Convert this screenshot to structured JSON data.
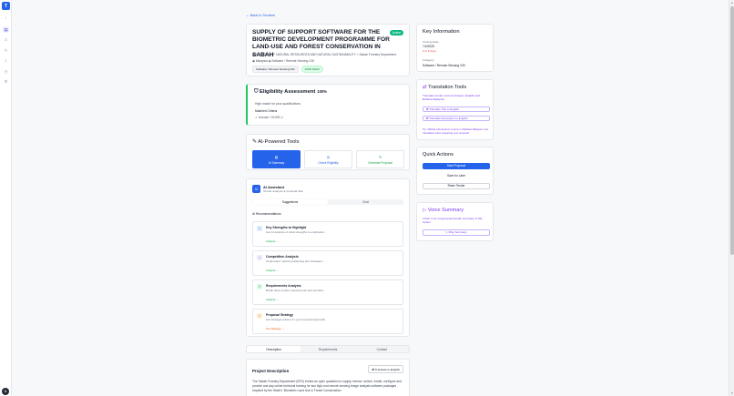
{
  "rail": {
    "logo": "T",
    "avatar": "N"
  },
  "back_link": "← Back to Tenders",
  "tender": {
    "title": "SUPPLY OF SUPPORT SOFTWARE FOR THE BIOMETRIC DEVELOPMENT PROGRAMME FOR LAND-USE AND FOREST CONSERVATION IN SABAH",
    "status": "Active",
    "ministry": "MINISTRY OF NATURAL RESOURCES AND NATURAL SUSTAINABILITY > Sabah Forestry Department",
    "location": "Malaysia",
    "category_meta": "Software / Remote Sensing GIS",
    "tag_category": "Software / Remote Sensing GIS",
    "tag_match": "100% Match"
  },
  "eligibility": {
    "title": "Eligibility Assessment",
    "percent": "100%",
    "subtitle": "High match for your qualifications",
    "matched_label": "Matched Criteria",
    "license": "License / 01/251-1"
  },
  "ai_tools": {
    "title": "AI-Powered Tools",
    "buttons": [
      "AI Summary",
      "Check Eligibility",
      "Generate Proposal"
    ]
  },
  "assistant": {
    "title": "AI Assistant",
    "subtitle": "Tender analysis & proposal help",
    "tabs": [
      "Suggestions",
      "Chat"
    ],
    "rec_heading": "AI Recommendations",
    "items": [
      {
        "title": "Key Strengths to Highlight",
        "desc": "Get AI analysis of what strengths to emphasize",
        "action": "Analyze →"
      },
      {
        "title": "Competition Analysis",
        "desc": "Understand market positioning and strategies",
        "action": "Analyze →"
      },
      {
        "title": "Requirements Analysis",
        "desc": "Break down tender requirements and priorities",
        "action": "Analyze →"
      },
      {
        "title": "Proposal Strategy",
        "desc": "Get strategic advice for your proposal approach",
        "action": "Get Strategy →"
      }
    ]
  },
  "bottom_tabs": [
    "Description",
    "Requirements",
    "Contact"
  ],
  "description": {
    "heading": "Project Description",
    "translate": "Translate to English",
    "text": "The Sabah Forestry Department (SFD) invites an open quotation to supply, license, deliver, install, configure and provide one-day online technical training for two high-end remote sensing image analysis software packages required by the State's \"Biometric Land Use & Forest Conservation"
  },
  "key_info": {
    "title": "Key Information",
    "closing_label": "Closing Date",
    "closing_value": "7/4/2025",
    "closing_warn": "0 in 6 days",
    "category_label": "Category",
    "category_value": "Software / Remote Sensing GIS"
  },
  "translation": {
    "title": "Translation Tools",
    "subtitle": "Translate tender content between English and Bahasa Malaysia",
    "btn_title": "Translate Title to English",
    "btn_desc": "Translate Description to English",
    "tip": "Tip: Official submissions must be in Bahasa Malaysia. Use translation when preparing your proposal."
  },
  "quick": {
    "title": "Quick Actions",
    "start": "Start Proposal",
    "save": "Save for Later",
    "share": "Share Tender"
  },
  "voice": {
    "title": "Voice Summary",
    "subtitle": "Listen to an AI-generated audio summary of this tender",
    "play": "Play Summary"
  }
}
